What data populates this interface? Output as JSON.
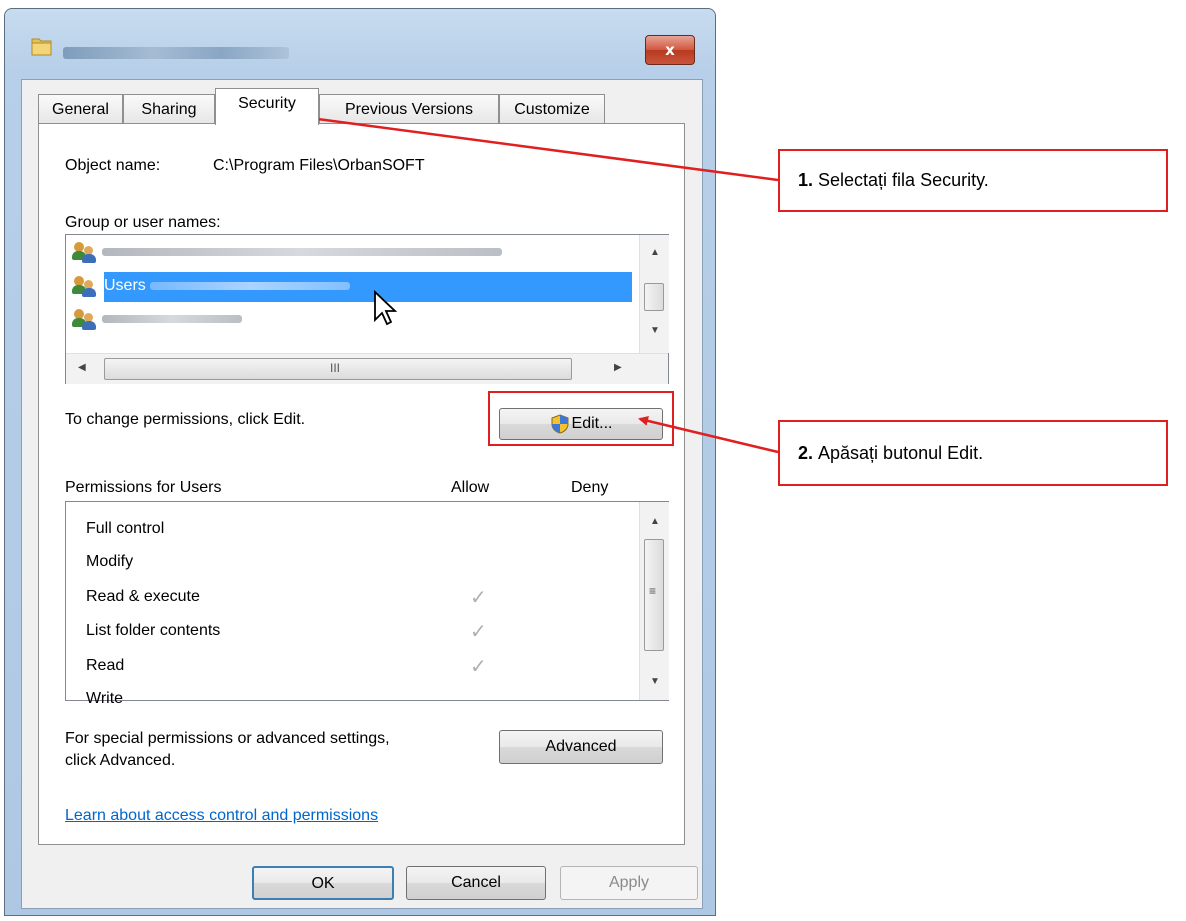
{
  "window": {
    "close_symbol": "x"
  },
  "tabs": [
    {
      "label": "General"
    },
    {
      "label": "Sharing"
    },
    {
      "label": "Security"
    },
    {
      "label": "Previous Versions"
    },
    {
      "label": "Customize"
    }
  ],
  "security": {
    "object_name_label": "Object name:",
    "object_name_value": "C:\\Program Files\\OrbanSOFT",
    "group_label": "Group or user names:",
    "groups": [
      {
        "name": ""
      },
      {
        "name": "Users"
      },
      {
        "name": ""
      }
    ],
    "hscroll_grip": "III",
    "change_text": "To change permissions, click Edit.",
    "edit_button": "Edit...",
    "permissions_label": "Permissions for Users",
    "allow_header": "Allow",
    "deny_header": "Deny",
    "permissions": [
      {
        "name": "Full control",
        "allow": false,
        "deny": false
      },
      {
        "name": "Modify",
        "allow": false,
        "deny": false
      },
      {
        "name": "Read & execute",
        "allow": true,
        "deny": false
      },
      {
        "name": "List folder contents",
        "allow": true,
        "deny": false
      },
      {
        "name": "Read",
        "allow": true,
        "deny": false
      },
      {
        "name": "Write",
        "allow": false,
        "deny": false
      }
    ],
    "check_glyph": "✓",
    "special_text_1": "For special permissions or advanced settings,",
    "special_text_2": "click Advanced.",
    "advanced_button": "Advanced",
    "learn_link": "Learn about access control and permissions"
  },
  "footer": {
    "ok": "OK",
    "cancel": "Cancel",
    "apply": "Apply"
  },
  "callouts": [
    {
      "num": "1.",
      "text": "Selectați fila Security."
    },
    {
      "num": "2.",
      "text": "Apăsați butonul Edit."
    }
  ],
  "colors": {
    "annotation": "#e02020",
    "selection": "#3399ff",
    "link": "#0066cc"
  }
}
